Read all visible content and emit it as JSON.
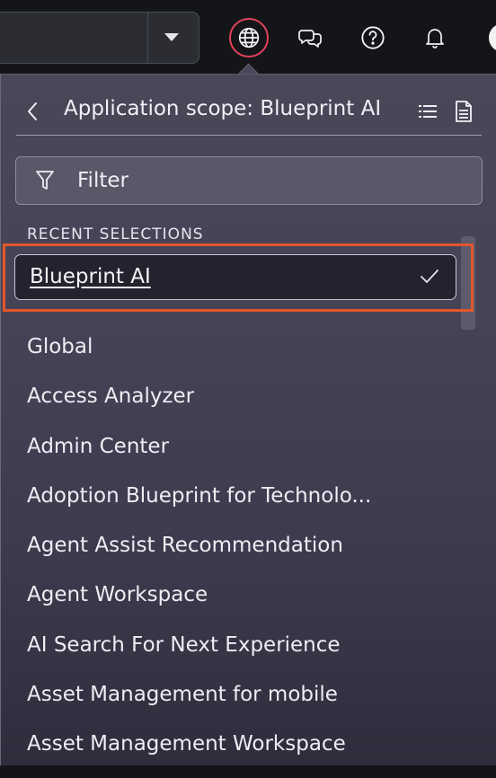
{
  "header": {
    "icons": [
      "chevron-down-icon",
      "globe-icon",
      "chat-icon",
      "help-icon",
      "bell-icon"
    ],
    "accent_color": "#e2435a"
  },
  "scope_panel": {
    "title": "Application scope: Blueprint AI",
    "filter_placeholder": "Filter",
    "recent_label": "RECENT SELECTIONS",
    "recent_selection": {
      "label": "Blueprint AI",
      "selected": true
    },
    "highlight_color": "#e2572c",
    "items": [
      "Global",
      "Access Analyzer",
      "Admin Center",
      "Adoption Blueprint for Technolo...",
      "Agent Assist Recommendation",
      "Agent Workspace",
      "AI Search For Next Experience",
      "Asset Management for mobile",
      "Asset Management Workspace"
    ]
  }
}
